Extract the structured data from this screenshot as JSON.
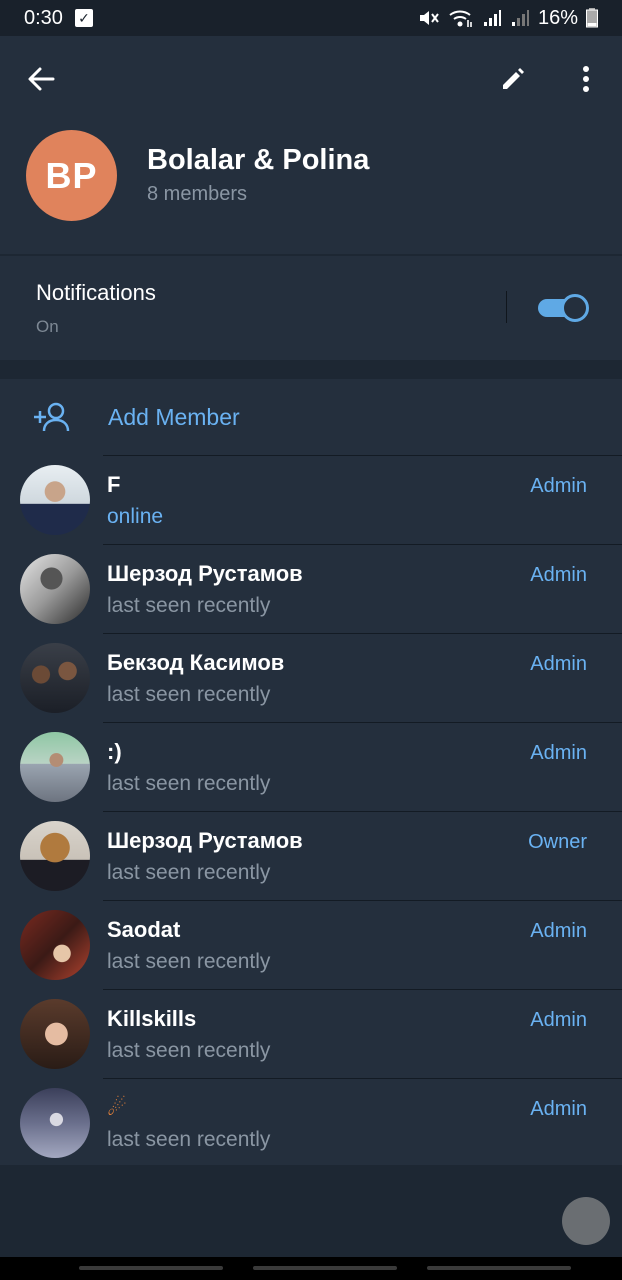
{
  "status_bar": {
    "time": "0:30",
    "battery": "16%",
    "icons": [
      "check-notification-icon",
      "mute-icon",
      "wifi-icon",
      "signal-icon",
      "signal-icon",
      "battery-icon"
    ]
  },
  "toolbar": {
    "back_icon": "arrow-left-icon",
    "edit_icon": "pencil-icon",
    "more_icon": "more-vertical-icon"
  },
  "group": {
    "avatar_initials": "BP",
    "avatar_color": "#e0835c",
    "title": "Bolalar & Polina",
    "members_count": "8 members"
  },
  "notifications": {
    "title": "Notifications",
    "state": "On",
    "enabled": true
  },
  "add_member": {
    "label": "Add Member",
    "icon": "add-user-icon"
  },
  "members": [
    {
      "name": "F",
      "status": "online",
      "role": "Admin",
      "online": true
    },
    {
      "name": "Шерзод Рустамов",
      "status": "last seen recently",
      "role": "Admin",
      "online": false
    },
    {
      "name": "Бекзод Касимов",
      "status": "last seen recently",
      "role": "Admin",
      "online": false
    },
    {
      "name": ":)",
      "status": "last seen recently",
      "role": "Admin",
      "online": false
    },
    {
      "name": "Шерзод Рустамов",
      "status": "last seen recently",
      "role": "Owner",
      "online": false
    },
    {
      "name": "Saodat",
      "status": "last seen recently",
      "role": "Admin",
      "online": false
    },
    {
      "name": "Killskills",
      "status": "last seen recently",
      "role": "Admin",
      "online": false
    },
    {
      "name": "☄",
      "status": "last seen recently",
      "role": "Admin",
      "online": false
    }
  ],
  "colors": {
    "accent": "#6ab2f2",
    "header_bg": "#242f3d",
    "page_bg": "#1d2733"
  }
}
